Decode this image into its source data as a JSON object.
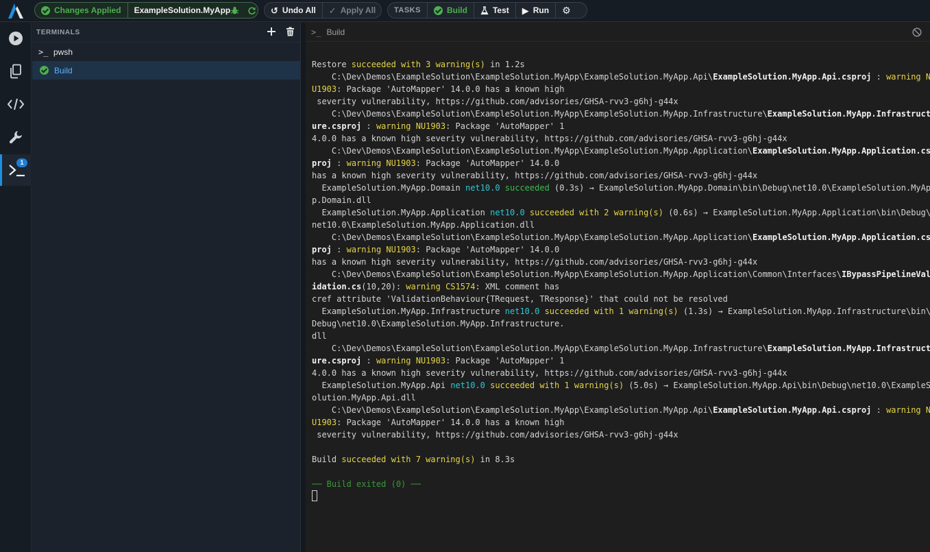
{
  "topbar": {
    "status": "Changes Applied",
    "project": "ExampleSolution.MyApp",
    "undo_all": "Undo All",
    "apply_all": "Apply All",
    "tasks": "TASKS",
    "build": "Build",
    "test": "Test",
    "run": "Run"
  },
  "colors": {
    "accent": "#1e8fe0",
    "success": "#4caf50",
    "warning": "#e5d448",
    "info": "#2ec7d6"
  },
  "activity": {
    "terminal_badge": "1",
    "icons": [
      "play-icon",
      "copy-icon",
      "code-icon",
      "wrench-icon",
      "terminal-icon"
    ]
  },
  "sidebar": {
    "title": "TERMINALS",
    "items": [
      {
        "label": "pwsh"
      },
      {
        "label": "Build"
      }
    ]
  },
  "pane": {
    "title": "Build"
  },
  "terminal_lines": [
    [
      [
        "",
        ""
      ]
    ],
    [
      [
        "Restore ",
        ""
      ],
      [
        "succeeded with 3 warning(s)",
        "y"
      ],
      [
        " in 1.2s",
        ""
      ]
    ],
    [
      [
        "    C:\\Dev\\Demos\\ExampleSolution\\ExampleSolution.MyApp\\ExampleSolution.MyApp.Api\\",
        ""
      ],
      [
        "ExampleSolution.MyApp.Api.csproj",
        "b"
      ],
      [
        " : ",
        ""
      ],
      [
        "warning N",
        "y"
      ]
    ],
    [
      [
        "U1903",
        "y"
      ],
      [
        ": Package 'AutoMapper' 14.0.0 has a known high",
        ""
      ]
    ],
    [
      [
        " severity vulnerability, https://github.com/advisories/GHSA-rvv3-g6hj-g44x",
        ""
      ]
    ],
    [
      [
        "    C:\\Dev\\Demos\\ExampleSolution\\ExampleSolution.MyApp\\ExampleSolution.MyApp.Infrastructure\\",
        ""
      ],
      [
        "ExampleSolution.MyApp.Infrastruct",
        "b"
      ]
    ],
    [
      [
        "ure.csproj",
        "b"
      ],
      [
        " : ",
        ""
      ],
      [
        "warning NU1903",
        "y"
      ],
      [
        ": Package 'AutoMapper' 1",
        ""
      ]
    ],
    [
      [
        "4.0.0 has a known high severity vulnerability, https://github.com/advisories/GHSA-rvv3-g6hj-g44x",
        ""
      ]
    ],
    [
      [
        "    C:\\Dev\\Demos\\ExampleSolution\\ExampleSolution.MyApp\\ExampleSolution.MyApp.Application\\",
        ""
      ],
      [
        "ExampleSolution.MyApp.Application.cs",
        "b"
      ]
    ],
    [
      [
        "proj",
        "b"
      ],
      [
        " : ",
        ""
      ],
      [
        "warning NU1903",
        "y"
      ],
      [
        ": Package 'AutoMapper' 14.0.0",
        ""
      ]
    ],
    [
      [
        "has a known high severity vulnerability, https://github.com/advisories/GHSA-rvv3-g6hj-g44x",
        ""
      ]
    ],
    [
      [
        "  ExampleSolution.MyApp.Domain ",
        ""
      ],
      [
        "net10.0",
        "c"
      ],
      [
        " ",
        ""
      ],
      [
        "succeeded",
        "g"
      ],
      [
        " (0.3s) → ExampleSolution.MyApp.Domain\\bin\\Debug\\net10.0\\ExampleSolution.MyAp",
        ""
      ]
    ],
    [
      [
        "p.Domain.dll",
        ""
      ]
    ],
    [
      [
        "  ExampleSolution.MyApp.Application ",
        ""
      ],
      [
        "net10.0",
        "c"
      ],
      [
        " ",
        ""
      ],
      [
        "succeeded with 2 warning(s)",
        "y"
      ],
      [
        " (0.6s) → ExampleSolution.MyApp.Application\\bin\\Debug\\",
        ""
      ]
    ],
    [
      [
        "net10.0\\ExampleSolution.MyApp.Application.dll",
        ""
      ]
    ],
    [
      [
        "    C:\\Dev\\Demos\\ExampleSolution\\ExampleSolution.MyApp\\ExampleSolution.MyApp.Application\\",
        ""
      ],
      [
        "ExampleSolution.MyApp.Application.cs",
        "b"
      ]
    ],
    [
      [
        "proj",
        "b"
      ],
      [
        " : ",
        ""
      ],
      [
        "warning NU1903",
        "y"
      ],
      [
        ": Package 'AutoMapper' 14.0.0",
        ""
      ]
    ],
    [
      [
        "has a known high severity vulnerability, https://github.com/advisories/GHSA-rvv3-g6hj-g44x",
        ""
      ]
    ],
    [
      [
        "    C:\\Dev\\Demos\\ExampleSolution\\ExampleSolution.MyApp\\ExampleSolution.MyApp.Application\\Common\\Interfaces\\",
        ""
      ],
      [
        "IBypassPipelineVal",
        "b"
      ]
    ],
    [
      [
        "idation.cs",
        "b"
      ],
      [
        "(10,20): ",
        ""
      ],
      [
        "warning CS1574",
        "y"
      ],
      [
        ": XML comment has",
        ""
      ]
    ],
    [
      [
        "cref attribute 'ValidationBehaviour{TRequest, TResponse}' that could not be resolved",
        ""
      ]
    ],
    [
      [
        "  ExampleSolution.MyApp.Infrastructure ",
        ""
      ],
      [
        "net10.0",
        "c"
      ],
      [
        " ",
        ""
      ],
      [
        "succeeded with 1 warning(s)",
        "y"
      ],
      [
        " (1.3s) → ExampleSolution.MyApp.Infrastructure\\bin\\",
        ""
      ]
    ],
    [
      [
        "Debug\\net10.0\\ExampleSolution.MyApp.Infrastructure.",
        ""
      ]
    ],
    [
      [
        "dll",
        ""
      ]
    ],
    [
      [
        "    C:\\Dev\\Demos\\ExampleSolution\\ExampleSolution.MyApp\\ExampleSolution.MyApp.Infrastructure\\",
        ""
      ],
      [
        "ExampleSolution.MyApp.Infrastruct",
        "b"
      ]
    ],
    [
      [
        "ure.csproj",
        "b"
      ],
      [
        " : ",
        ""
      ],
      [
        "warning NU1903",
        "y"
      ],
      [
        ": Package 'AutoMapper' 1",
        ""
      ]
    ],
    [
      [
        "4.0.0 has a known high severity vulnerability, https://github.com/advisories/GHSA-rvv3-g6hj-g44x",
        ""
      ]
    ],
    [
      [
        "  ExampleSolution.MyApp.Api ",
        ""
      ],
      [
        "net10.0",
        "c"
      ],
      [
        " ",
        ""
      ],
      [
        "succeeded with 1 warning(s)",
        "y"
      ],
      [
        " (5.0s) → ExampleSolution.MyApp.Api\\bin\\Debug\\net10.0\\ExampleS",
        ""
      ]
    ],
    [
      [
        "olution.MyApp.Api.dll",
        ""
      ]
    ],
    [
      [
        "    C:\\Dev\\Demos\\ExampleSolution\\ExampleSolution.MyApp\\ExampleSolution.MyApp.Api\\",
        ""
      ],
      [
        "ExampleSolution.MyApp.Api.csproj",
        "b"
      ],
      [
        " : ",
        ""
      ],
      [
        "warning N",
        "y"
      ]
    ],
    [
      [
        "U1903",
        "y"
      ],
      [
        ": Package 'AutoMapper' 14.0.0 has a known high",
        ""
      ]
    ],
    [
      [
        " severity vulnerability, https://github.com/advisories/GHSA-rvv3-g6hj-g44x",
        ""
      ]
    ],
    [
      [
        "",
        ""
      ]
    ],
    [
      [
        "Build ",
        ""
      ],
      [
        "succeeded with 7 warning(s)",
        "y"
      ],
      [
        " in 8.3s",
        ""
      ]
    ],
    [
      [
        "",
        ""
      ]
    ],
    [
      [
        "── Build exited (0) ──",
        "ex"
      ]
    ]
  ]
}
